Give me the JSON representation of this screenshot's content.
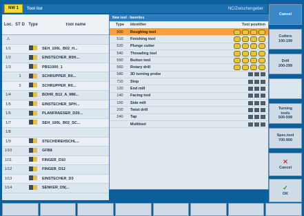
{
  "title": {
    "mode_badge": "NW 1",
    "list_label": "Tool list",
    "nc_label": "NC/Zwischengeber"
  },
  "left_table": {
    "headers": [
      "Loc.",
      "ST D",
      "Type",
      "Tool name"
    ],
    "rows": [
      {
        "loc": "⚠",
        "st": "",
        "type": "",
        "name": ""
      },
      {
        "loc": "1/1",
        "st": "",
        "type": "drill",
        "name": "SEH_100L_B02_H..."
      },
      {
        "loc": "1/2",
        "st": "",
        "type": "drill",
        "name": "EINSTECHER_R0H..."
      },
      {
        "loc": "1/3",
        "st": "",
        "type": "drill",
        "name": "PBS1000_1"
      },
      {
        "loc": "",
        "st": "1",
        "type": "drill",
        "name": "SCHRUPPER_R0..."
      },
      {
        "loc": "",
        "st": "2",
        "type": "drill",
        "name": "SCHRUPPER_R0..."
      },
      {
        "loc": "1/4",
        "st": "",
        "type": "drill",
        "name": "BOHR_B12_A_MM..."
      },
      {
        "loc": "1/5",
        "st": "",
        "type": "drill",
        "name": "EINSTECHER_SPH..."
      },
      {
        "loc": "1/6",
        "st": "",
        "type": "drill",
        "name": "PLANFRAESER_D20..."
      },
      {
        "loc": "1/7",
        "st": "",
        "type": "drill",
        "name": "SEH_100L_B02_SC..."
      },
      {
        "loc": "1/8",
        "st": "",
        "type": "",
        "name": ""
      },
      {
        "loc": "1/9",
        "st": "",
        "type": "drill",
        "name": "STECHDREHSCHL..."
      },
      {
        "loc": "1/10",
        "st": "",
        "type": "drill",
        "name": "GFB8"
      },
      {
        "loc": "1/11",
        "st": "",
        "type": "drill",
        "name": "FINGER_D10"
      },
      {
        "loc": "1/12",
        "st": "",
        "type": "drill",
        "name": "FINGER_D12"
      },
      {
        "loc": "1/13",
        "st": "",
        "type": "drill",
        "name": "EINSTECHER_D3"
      },
      {
        "loc": "1/14",
        "st": "",
        "type": "drill",
        "name": "SENKER_D9(..."
      }
    ]
  },
  "popup": {
    "title": "New tool - favorites",
    "headers": [
      "Type",
      "Identifier",
      "Tool position"
    ],
    "rows": [
      {
        "type": "500",
        "id": "Roughing tool",
        "selected": true
      },
      {
        "type": "510",
        "id": "Finishing tool"
      },
      {
        "type": "520",
        "id": "Plunge cutter"
      },
      {
        "type": "540",
        "id": "Threading tool"
      },
      {
        "type": "550",
        "id": "Button tool"
      },
      {
        "type": "560",
        "id": "Rotary drill"
      },
      {
        "type": "580",
        "id": "3D turning probe"
      },
      {
        "type": "710",
        "id": "Stop"
      },
      {
        "type": "120",
        "id": "End mill"
      },
      {
        "type": "140",
        "id": "Facing tool"
      },
      {
        "type": "150",
        "id": "Side mill"
      },
      {
        "type": "200",
        "id": "Twist drill"
      },
      {
        "type": "240",
        "id": "Tap"
      },
      {
        "type": "",
        "id": "Multitool"
      }
    ]
  },
  "softkeys": {
    "cancel": "Cancel",
    "cutters": "Cutters\n100-199",
    "drill": "Drill\n200-299",
    "turning": "Turning\ntools\n500-599",
    "special": "Spec.tool\n700-900",
    "abort": "Cancel",
    "ok": "OK"
  },
  "colors": {
    "accent": "#0b5f9b",
    "selected_row": "#f6a03a",
    "badge": "#f3dc3b"
  }
}
